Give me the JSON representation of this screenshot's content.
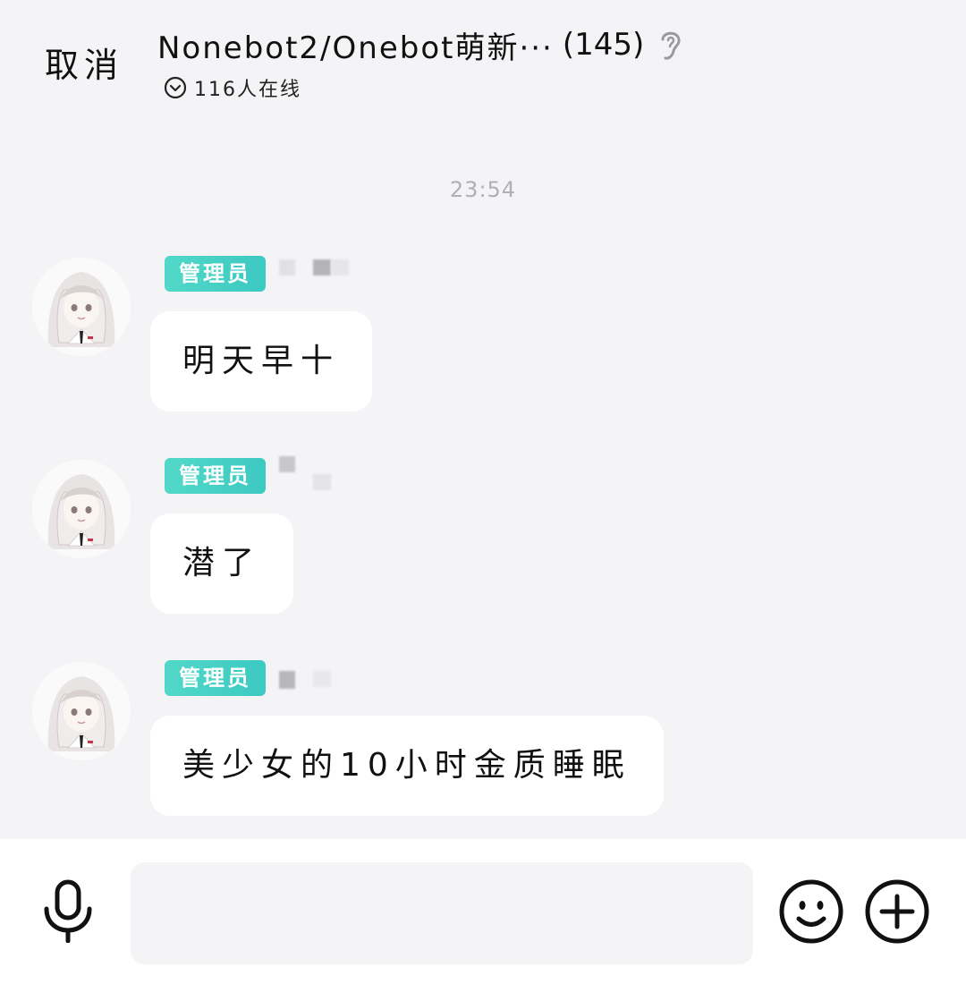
{
  "header": {
    "cancel_label": "取消",
    "group_name": "Nonebot2/Onebot萌新···",
    "member_count": "(145)",
    "online_text": "116人在线",
    "ear_icon": "ear-icon",
    "chevron_icon": "chevron-down-circle-icon"
  },
  "timestamp": "23:54",
  "messages": [
    {
      "role_badge": "管理员",
      "text": "明天早十",
      "avatar_icon": "anime-girl-avatar"
    },
    {
      "role_badge": "管理员",
      "text": "潜了",
      "avatar_icon": "anime-girl-avatar"
    },
    {
      "role_badge": "管理员",
      "text": "美少女的10小时金质睡眠",
      "avatar_icon": "anime-girl-avatar"
    }
  ],
  "input_bar": {
    "placeholder": "",
    "mic_icon": "microphone-icon",
    "emoji_icon": "smiley-icon",
    "plus_icon": "plus-circle-icon"
  },
  "colors": {
    "background": "#f4f4f6",
    "badge": "#46d0c6",
    "bubble": "#ffffff",
    "timestamp": "#b0b0b4"
  }
}
